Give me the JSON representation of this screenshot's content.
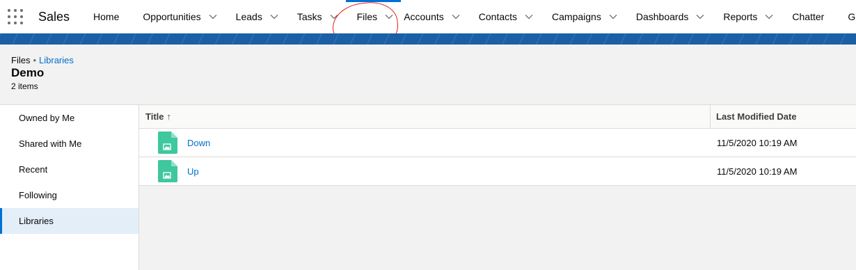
{
  "app": {
    "name": "Sales"
  },
  "nav": {
    "items": [
      {
        "label": "Home",
        "dropdown": false
      },
      {
        "label": "Opportunities",
        "dropdown": true
      },
      {
        "label": "Leads",
        "dropdown": true
      },
      {
        "label": "Tasks",
        "dropdown": true
      },
      {
        "label": "Files",
        "dropdown": true,
        "active": true
      },
      {
        "label": "Accounts",
        "dropdown": true
      },
      {
        "label": "Contacts",
        "dropdown": true
      },
      {
        "label": "Campaigns",
        "dropdown": true
      },
      {
        "label": "Dashboards",
        "dropdown": true
      },
      {
        "label": "Reports",
        "dropdown": true
      },
      {
        "label": "Chatter",
        "dropdown": false
      },
      {
        "label": "Groups",
        "dropdown": false
      }
    ]
  },
  "header": {
    "breadcrumb_root": "Files",
    "breadcrumb_sep": "•",
    "breadcrumb_link": "Libraries",
    "title": "Demo",
    "count": "2 items"
  },
  "sidebar": {
    "items": [
      {
        "label": "Owned by Me"
      },
      {
        "label": "Shared with Me"
      },
      {
        "label": "Recent"
      },
      {
        "label": "Following"
      },
      {
        "label": "Libraries",
        "active": true
      }
    ]
  },
  "table": {
    "columns": {
      "title": "Title",
      "sort_arrow": "↑",
      "date": "Last Modified Date"
    },
    "rows": [
      {
        "title": "Down",
        "modified": "11/5/2020 10:19 AM"
      },
      {
        "title": "Up",
        "modified": "11/5/2020 10:19 AM"
      }
    ]
  },
  "colors": {
    "accent": "#0070d2",
    "link": "#006dcc",
    "file_icon": "#3fc79e",
    "annotation": "#e02020"
  }
}
